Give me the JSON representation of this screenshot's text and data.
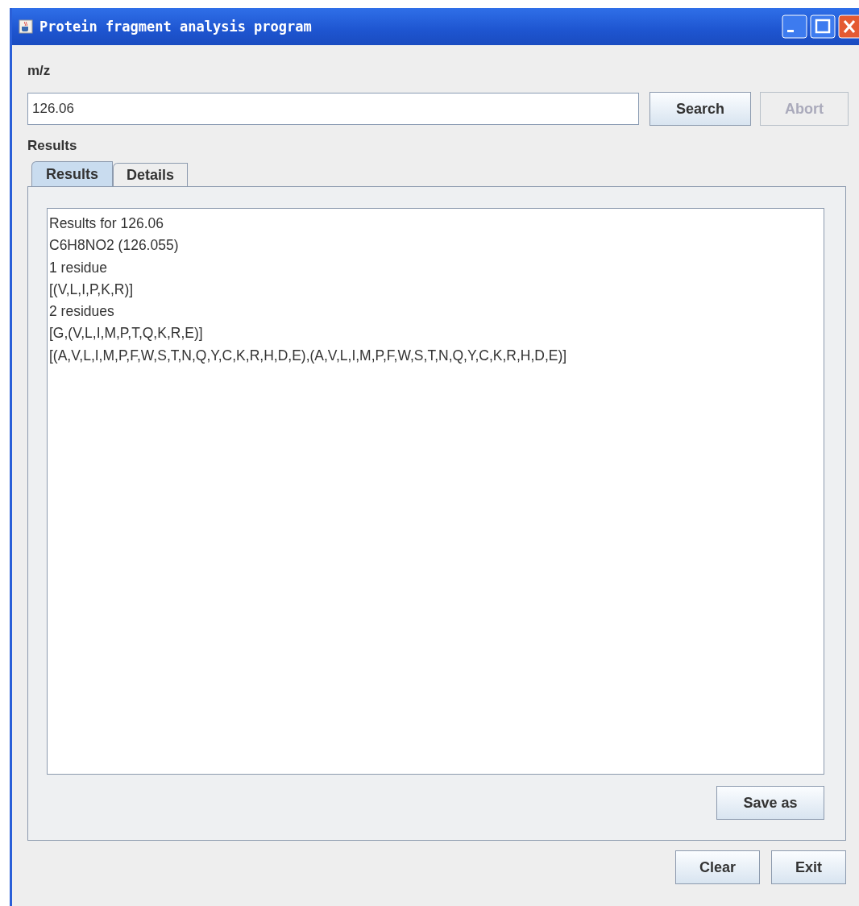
{
  "window": {
    "title": "Protein fragment analysis program"
  },
  "mz": {
    "label": "m/z",
    "value": "126.06"
  },
  "actions": [
    {
      "label": "Search",
      "disabled": false
    },
    {
      "label": "Abort",
      "disabled": true
    }
  ],
  "results_label": "Results",
  "tabs": [
    {
      "label": "Results",
      "selected": true
    },
    {
      "label": "Details",
      "selected": false
    }
  ],
  "output_lines": [
    "Results for 126.06",
    "C6H8NO2 (126.055)",
    "1 residue",
    "[(V,L,I,P,K,R)]",
    "2 residues",
    "[G,(V,L,I,M,P,T,Q,K,R,E)]",
    "[(A,V,L,I,M,P,F,W,S,T,N,Q,Y,C,K,R,H,D,E),(A,V,L,I,M,P,F,W,S,T,N,Q,Y,C,K,R,H,D,E)]"
  ],
  "save_button": "Save as",
  "bottom_buttons": [
    "Clear",
    "Exit"
  ]
}
